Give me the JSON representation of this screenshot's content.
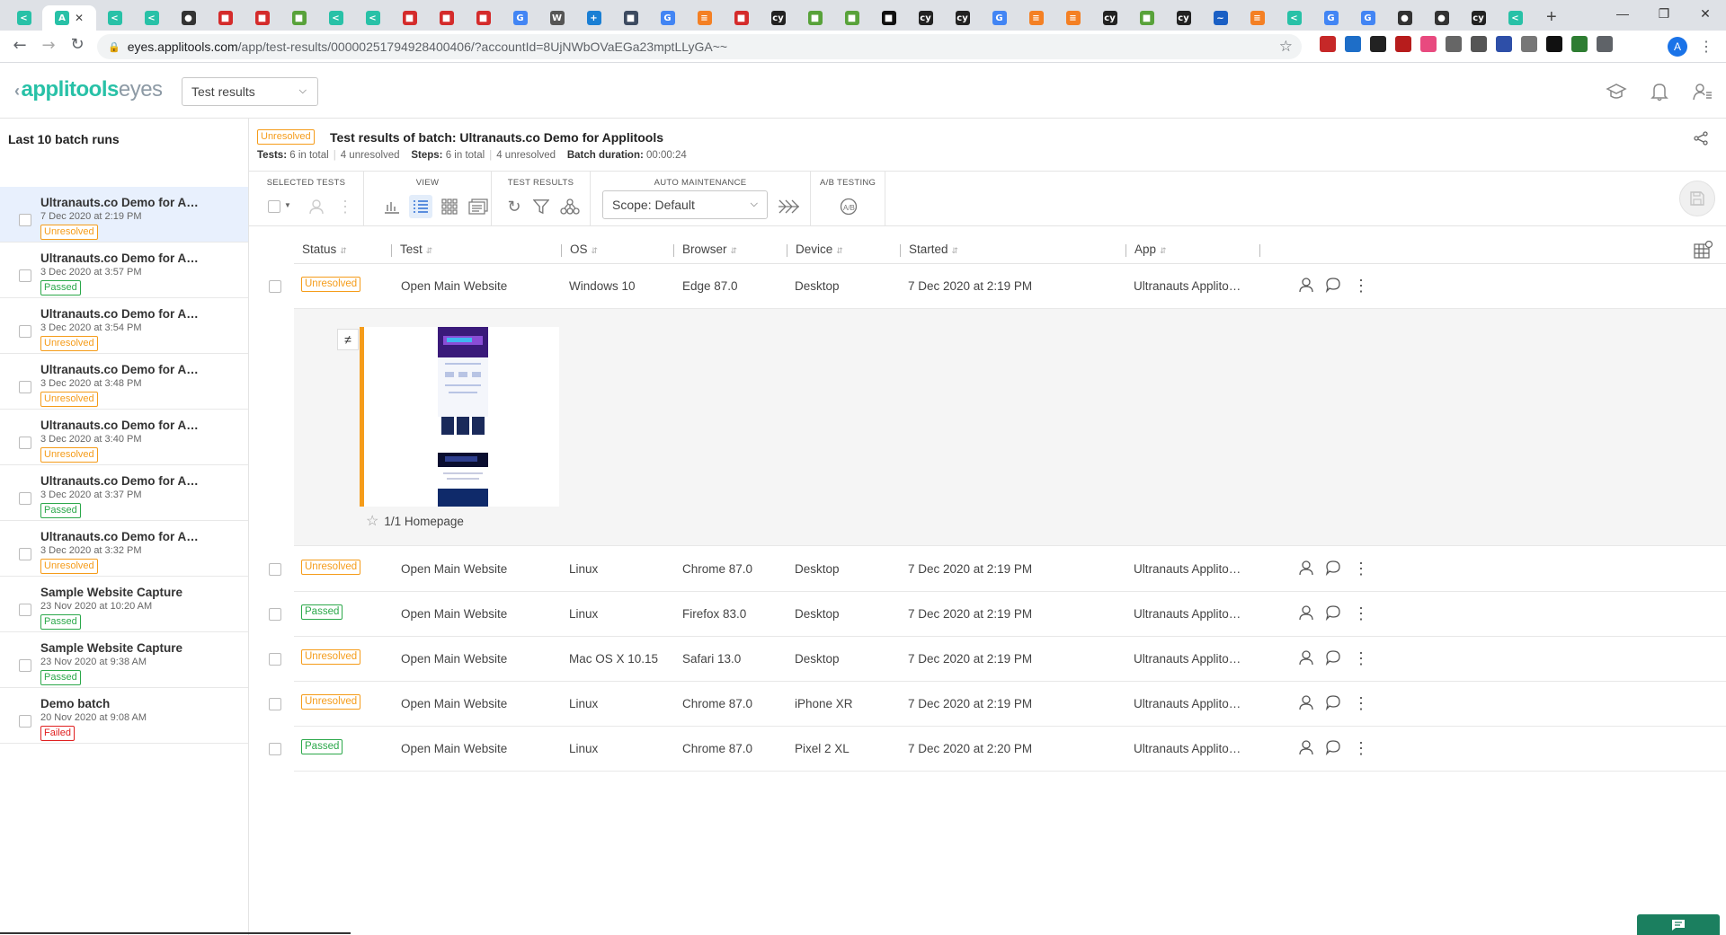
{
  "browser": {
    "url_host": "eyes.applitools.com",
    "url_path": "/app/test-results/00000251794928400406/?accountId=8UjNWbOVaEGa23mptLLyGA~~",
    "tabs": [
      {
        "icon": "applitools-icon",
        "color": "#28c1a7",
        "glyph": "<"
      },
      {
        "icon": "applitools-active-icon",
        "color": "#28c1a7",
        "glyph": "A",
        "active": true
      },
      {
        "icon": "applitools-icon",
        "color": "#28c1a7",
        "glyph": "<"
      },
      {
        "icon": "applitools-icon",
        "color": "#28c1a7",
        "glyph": "<"
      },
      {
        "icon": "github-icon",
        "color": "#333333",
        "glyph": "●"
      },
      {
        "icon": "red-tab-icon",
        "color": "#d42b2b",
        "glyph": "■"
      },
      {
        "icon": "red-tab-icon",
        "color": "#d42b2b",
        "glyph": "■"
      },
      {
        "icon": "green-tab-icon",
        "color": "#58a23a",
        "glyph": "■"
      },
      {
        "icon": "applitools-icon",
        "color": "#28c1a7",
        "glyph": "<"
      },
      {
        "icon": "applitools-icon",
        "color": "#28c1a7",
        "glyph": "<"
      },
      {
        "icon": "red-tab-icon",
        "color": "#d42b2b",
        "glyph": "■"
      },
      {
        "icon": "red-tab-icon",
        "color": "#d42b2b",
        "glyph": "■"
      },
      {
        "icon": "red-tab-icon",
        "color": "#d42b2b",
        "glyph": "■"
      },
      {
        "icon": "google-icon",
        "color": "#4285f4",
        "glyph": "G"
      },
      {
        "icon": "wikipedia-icon",
        "color": "#555555",
        "glyph": "W"
      },
      {
        "icon": "blue-cross-icon",
        "color": "#1a7fd4",
        "glyph": "+"
      },
      {
        "icon": "dark-tab-icon",
        "color": "#3c4a60",
        "glyph": "■"
      },
      {
        "icon": "google-icon",
        "color": "#4285f4",
        "glyph": "G"
      },
      {
        "icon": "stack-icon",
        "color": "#f48024",
        "glyph": "≡"
      },
      {
        "icon": "red-tab-icon",
        "color": "#d42b2b",
        "glyph": "■"
      },
      {
        "icon": "cypress-icon",
        "color": "#222222",
        "glyph": "cy"
      },
      {
        "icon": "green-tab-icon",
        "color": "#58a23a",
        "glyph": "■"
      },
      {
        "icon": "green-tab-icon",
        "color": "#58a23a",
        "glyph": "■"
      },
      {
        "icon": "dark-tab-icon",
        "color": "#111111",
        "glyph": "■"
      },
      {
        "icon": "cypress-icon",
        "color": "#222222",
        "glyph": "cy"
      },
      {
        "icon": "cypress-icon",
        "color": "#222222",
        "glyph": "cy"
      },
      {
        "icon": "google-icon",
        "color": "#4285f4",
        "glyph": "G"
      },
      {
        "icon": "stack-icon",
        "color": "#f48024",
        "glyph": "≡"
      },
      {
        "icon": "stack-icon",
        "color": "#f48024",
        "glyph": "≡"
      },
      {
        "icon": "cypress-icon",
        "color": "#222222",
        "glyph": "cy"
      },
      {
        "icon": "green-tab-icon",
        "color": "#58a23a",
        "glyph": "■"
      },
      {
        "icon": "cypress-icon",
        "color": "#222222",
        "glyph": "cy"
      },
      {
        "icon": "blue-wave-icon",
        "color": "#1a5fc4",
        "glyph": "~"
      },
      {
        "icon": "stack-icon",
        "color": "#f48024",
        "glyph": "≡"
      },
      {
        "icon": "applitools-icon",
        "color": "#28c1a7",
        "glyph": "<"
      },
      {
        "icon": "google-icon",
        "color": "#4285f4",
        "glyph": "G"
      },
      {
        "icon": "google-icon",
        "color": "#4285f4",
        "glyph": "G"
      },
      {
        "icon": "github-icon",
        "color": "#333333",
        "glyph": "●"
      },
      {
        "icon": "github-icon",
        "color": "#333333",
        "glyph": "●"
      },
      {
        "icon": "cypress-icon",
        "color": "#222222",
        "glyph": "cy"
      },
      {
        "icon": "applitools-icon",
        "color": "#28c1a7",
        "glyph": "<"
      }
    ],
    "extensions": [
      {
        "icon": "ext-red-icon",
        "color": "#c62828"
      },
      {
        "icon": "ext-blue-icon",
        "color": "#1e6ec8"
      },
      {
        "icon": "ext-chat-icon",
        "color": "#222222"
      },
      {
        "icon": "ext-red2-icon",
        "color": "#b71c1c"
      },
      {
        "icon": "ext-pink-icon",
        "color": "#e84a7f"
      },
      {
        "icon": "ext-ip-icon",
        "color": "#666666"
      },
      {
        "icon": "ext-drive-icon",
        "color": "#555555"
      },
      {
        "icon": "ext-search-icon",
        "color": "#2e4fa8"
      },
      {
        "icon": "ext-camera-icon",
        "color": "#777777"
      },
      {
        "icon": "ext-pd-icon",
        "color": "#111111"
      },
      {
        "icon": "ext-green-icon",
        "color": "#2e7d32"
      },
      {
        "icon": "puzzle-icon",
        "color": "#5f6368"
      }
    ],
    "profile_initial": "A"
  },
  "header": {
    "logo_main": "applitools",
    "logo_secondary": "eyes",
    "view_select": "Test results"
  },
  "sidebar": {
    "title": "Last 10 batch runs",
    "batches": [
      {
        "name": "Ultranauts.co Demo for A…",
        "date": "7 Dec 2020 at 2:19 PM",
        "status": "Unresolved",
        "status_class": "unresolved",
        "selected": true
      },
      {
        "name": "Ultranauts.co Demo for A…",
        "date": "3 Dec 2020 at 3:57 PM",
        "status": "Passed",
        "status_class": "passed"
      },
      {
        "name": "Ultranauts.co Demo for A…",
        "date": "3 Dec 2020 at 3:54 PM",
        "status": "Unresolved",
        "status_class": "unresolved"
      },
      {
        "name": "Ultranauts.co Demo for A…",
        "date": "3 Dec 2020 at 3:48 PM",
        "status": "Unresolved",
        "status_class": "unresolved"
      },
      {
        "name": "Ultranauts.co Demo for A…",
        "date": "3 Dec 2020 at 3:40 PM",
        "status": "Unresolved",
        "status_class": "unresolved"
      },
      {
        "name": "Ultranauts.co Demo for A…",
        "date": "3 Dec 2020 at 3:37 PM",
        "status": "Passed",
        "status_class": "passed"
      },
      {
        "name": "Ultranauts.co Demo for A…",
        "date": "3 Dec 2020 at 3:32 PM",
        "status": "Unresolved",
        "status_class": "unresolved"
      },
      {
        "name": "Sample Website Capture",
        "date": "23 Nov 2020 at 10:20 AM",
        "status": "Passed",
        "status_class": "passed"
      },
      {
        "name": "Sample Website Capture",
        "date": "23 Nov 2020 at 9:38 AM",
        "status": "Passed",
        "status_class": "passed"
      },
      {
        "name": "Demo batch",
        "date": "20 Nov 2020 at 9:08 AM",
        "status": "Failed",
        "status_class": "failed"
      }
    ]
  },
  "batch": {
    "status": "Unresolved",
    "title": "Test results of batch:  Ultranauts.co Demo for Applitools",
    "tests_label": "Tests:",
    "tests_total": "6 in total",
    "tests_unresolved": "4 unresolved",
    "steps_label": "Steps:",
    "steps_total": "6 in total",
    "steps_unresolved": "4 unresolved",
    "duration_label": "Batch duration:",
    "duration": "00:00:24"
  },
  "toolbar": {
    "selected_tests": "SELECTED TESTS",
    "view": "VIEW",
    "test_results": "TEST RESULTS",
    "auto_maintenance": "AUTO MAINTENANCE",
    "ab_testing": "A/B TESTING",
    "scope": "Scope: Default"
  },
  "table": {
    "columns": [
      "Status",
      "Test",
      "OS",
      "Browser",
      "Device",
      "Started",
      "App"
    ],
    "rows": [
      {
        "status": "Unresolved",
        "status_class": "unresolved",
        "test": "Open Main Website",
        "os": "Windows 10",
        "browser": "Edge 87.0",
        "device": "Desktop",
        "started": "7 Dec 2020 at 2:19 PM",
        "app": "Ultranauts Applito…"
      },
      {
        "status": "Unresolved",
        "status_class": "unresolved",
        "test": "Open Main Website",
        "os": "Linux",
        "browser": "Chrome 87.0",
        "device": "Desktop",
        "started": "7 Dec 2020 at 2:19 PM",
        "app": "Ultranauts Applito…"
      },
      {
        "status": "Passed",
        "status_class": "passed",
        "test": "Open Main Website",
        "os": "Linux",
        "browser": "Firefox 83.0",
        "device": "Desktop",
        "started": "7 Dec 2020 at 2:19 PM",
        "app": "Ultranauts Applito…"
      },
      {
        "status": "Unresolved",
        "status_class": "unresolved",
        "test": "Open Main Website",
        "os": "Mac OS X 10.15",
        "browser": "Safari 13.0",
        "device": "Desktop",
        "started": "7 Dec 2020 at 2:19 PM",
        "app": "Ultranauts Applito…"
      },
      {
        "status": "Unresolved",
        "status_class": "unresolved",
        "test": "Open Main Website",
        "os": "Linux",
        "browser": "Chrome 87.0",
        "device": "iPhone XR",
        "started": "7 Dec 2020 at 2:19 PM",
        "app": "Ultranauts Applito…"
      },
      {
        "status": "Passed",
        "status_class": "passed",
        "test": "Open Main Website",
        "os": "Linux",
        "browser": "Chrome 87.0",
        "device": "Pixel 2 XL",
        "started": "7 Dec 2020 at 2:20 PM",
        "app": "Ultranauts Applito…"
      }
    ],
    "expanded_step": "1/1 Homepage"
  },
  "colors": {
    "brand": "#28c1a7",
    "unresolved": "#f59c1a",
    "passed": "#2ba84a",
    "failed": "#e02020",
    "selected_row": "#e8f0fd",
    "chat_button": "#1b7f5f"
  }
}
